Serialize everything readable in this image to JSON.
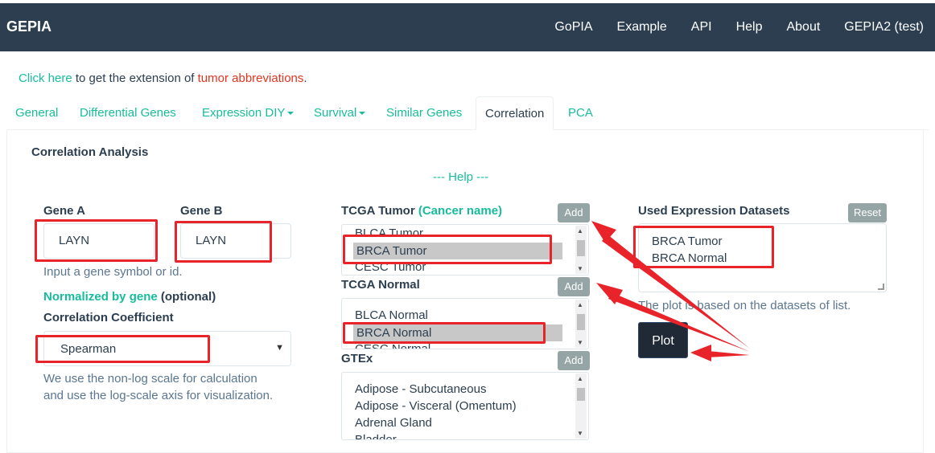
{
  "navbar": {
    "brand": "GEPIA",
    "links": [
      "GoPIA",
      "Example",
      "API",
      "Help",
      "About",
      "GEPIA2 (test)"
    ]
  },
  "ext_line": {
    "link1": "Click here",
    "middle": " to get the extension of ",
    "link2": "tumor abbreviations",
    "end": "."
  },
  "tabs": [
    "General",
    "Differential Genes",
    "Expression DIY",
    "Survival",
    "Similar Genes",
    "Correlation",
    "PCA"
  ],
  "active_tab": "Correlation",
  "analysis": {
    "title": "Correlation Analysis",
    "help": "--- Help ---",
    "gene_a_label": "Gene A",
    "gene_b_label": "Gene B",
    "gene_a_value": "LAYN",
    "gene_b_value": "LAYN",
    "gene_hint": "Input a gene symbol or id.",
    "normalized_link": "Normalized by gene",
    "normalized_optional": " (optional)",
    "coef_label": "Correlation Coefficient",
    "coef_value": "Spearman",
    "scale_hint_1": "We use the non-log scale for calculation",
    "scale_hint_2": "and use the log-scale axis for visualization."
  },
  "tcga_tumor": {
    "label": "TCGA Tumor",
    "label_extra": "(Cancer name)",
    "add": "Add",
    "options": [
      "BLCA Tumor",
      "BRCA Tumor",
      "CESC Tumor"
    ],
    "selected": "BRCA Tumor"
  },
  "tcga_normal": {
    "label": "TCGA Normal",
    "add": "Add",
    "options": [
      "BLCA Normal",
      "BRCA Normal",
      "CESC Normal"
    ],
    "selected": "BRCA Normal"
  },
  "gtex": {
    "label": "GTEx",
    "add": "Add",
    "options": [
      "Adipose - Subcutaneous",
      "Adipose - Visceral (Omentum)",
      "Adrenal Gland",
      "Bladder"
    ]
  },
  "datasets": {
    "label": "Used Expression Datasets",
    "reset": "Reset",
    "values": [
      "BRCA Tumor",
      "BRCA Normal"
    ],
    "note": "The plot is based on the datasets of list.",
    "plot": "Plot"
  },
  "colors": {
    "navbar": "#2c3e50",
    "accent": "#18bc9c",
    "annotation_red": "#e8232a"
  }
}
